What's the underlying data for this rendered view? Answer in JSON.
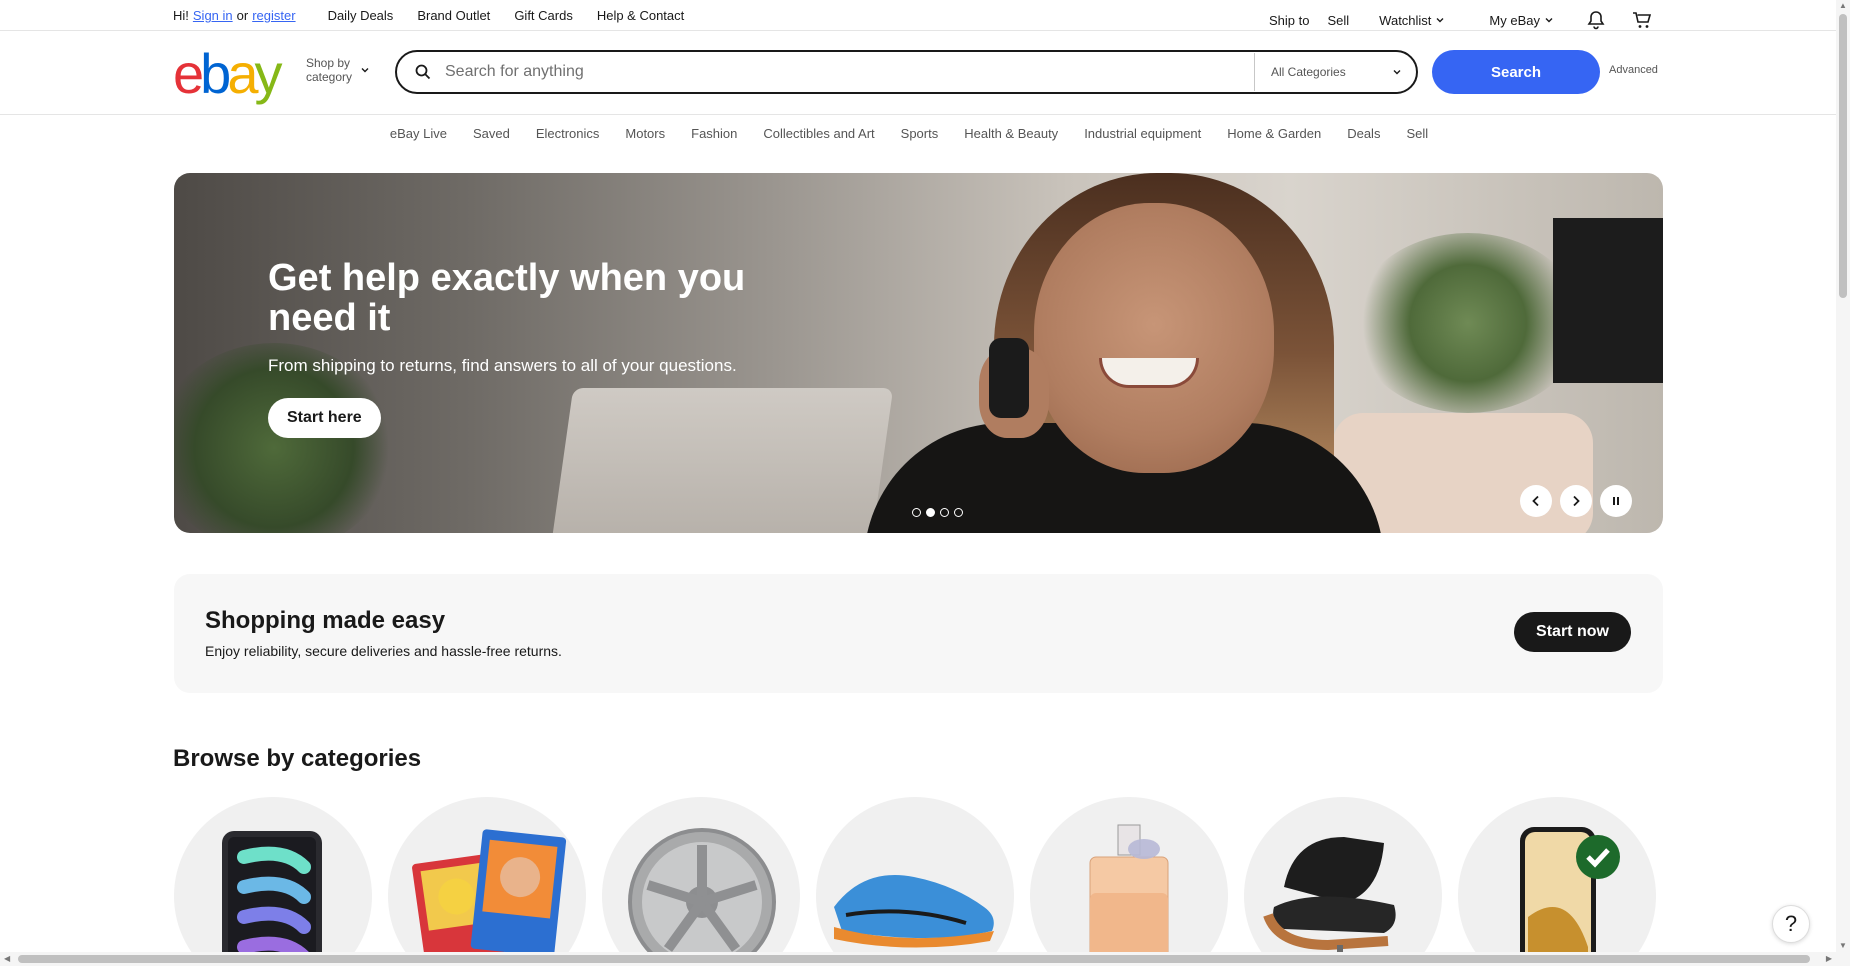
{
  "topbar": {
    "greeting_prefix": "Hi!",
    "sign_in": "Sign in",
    "or": "or",
    "register": "register",
    "links": [
      "Daily Deals",
      "Brand Outlet",
      "Gift Cards",
      "Help & Contact"
    ],
    "ship_to": "Ship to",
    "sell": "Sell",
    "watchlist": "Watchlist",
    "my_ebay": "My eBay"
  },
  "header": {
    "logo": "ebay",
    "shop_by": "Shop by",
    "category": "category",
    "search_placeholder": "Search for anything",
    "category_select": "All Categories",
    "search_button": "Search",
    "advanced": "Advanced"
  },
  "nav": [
    "eBay Live",
    "Saved",
    "Electronics",
    "Motors",
    "Fashion",
    "Collectibles and Art",
    "Sports",
    "Health & Beauty",
    "Industrial equipment",
    "Home & Garden",
    "Deals",
    "Sell"
  ],
  "hero": {
    "title": "Get help exactly when you need it",
    "subtitle": "From shipping to returns, find answers to all of your questions.",
    "button": "Start here",
    "slides": 4,
    "active_slide": 2
  },
  "easy": {
    "title": "Shopping made easy",
    "subtitle": "Enjoy reliability, secure deliveries and hassle-free returns.",
    "button": "Start now"
  },
  "browse": {
    "title": "Browse by categories",
    "items": [
      "tablet",
      "trading-cards",
      "alloy-wheel",
      "sneaker",
      "perfume",
      "lounge-chair",
      "smartphone"
    ]
  },
  "help": "?",
  "colors": {
    "accent": "#3665f3",
    "logo_e": "#e53238",
    "logo_b": "#0064d2",
    "logo_a": "#f5af02",
    "logo_y": "#86b817"
  }
}
